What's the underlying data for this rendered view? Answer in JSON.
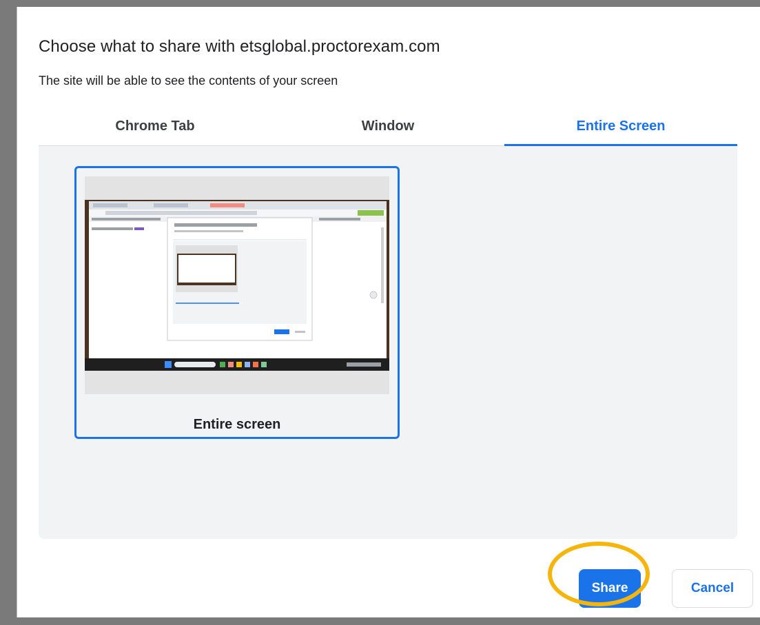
{
  "dialog": {
    "title": "Choose what to share with etsglobal.proctorexam.com",
    "subtitle": "The site will be able to see the contents of your screen"
  },
  "tabs": [
    {
      "label": "Chrome Tab",
      "active": false
    },
    {
      "label": "Window",
      "active": false
    },
    {
      "label": "Entire Screen",
      "active": true
    }
  ],
  "sources": [
    {
      "label": "Entire screen",
      "selected": true,
      "thumbnail_icon": "screen-preview-icon"
    }
  ],
  "actions": {
    "share_label": "Share",
    "cancel_label": "Cancel"
  },
  "colors": {
    "accent": "#1a73e8",
    "highlight": "#f5b50a",
    "panel": "#f1f3f4"
  }
}
